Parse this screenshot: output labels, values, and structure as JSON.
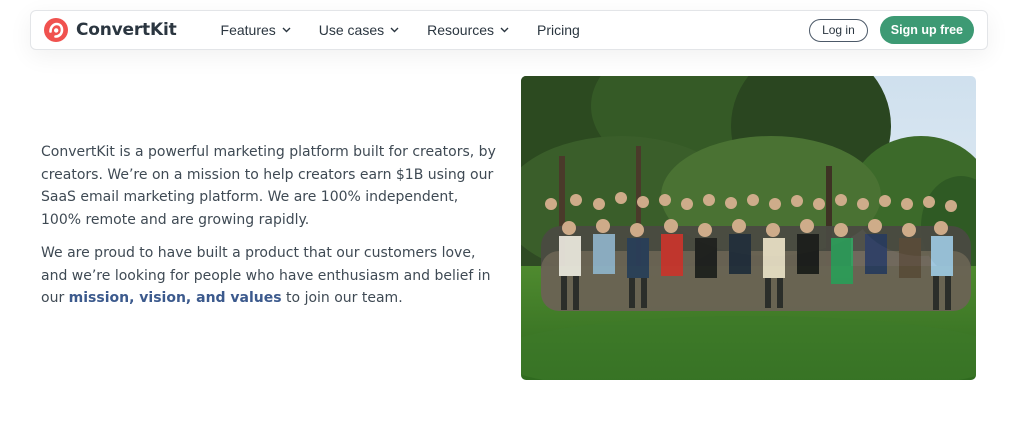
{
  "header": {
    "brand": "ConvertKit",
    "logo_icon": "convertkit-logo-icon",
    "nav": [
      {
        "label": "Features",
        "has_dropdown": true
      },
      {
        "label": "Use cases",
        "has_dropdown": true
      },
      {
        "label": "Resources",
        "has_dropdown": true
      },
      {
        "label": "Pricing",
        "has_dropdown": false
      }
    ],
    "login_label": "Log in",
    "signup_label": "Sign up free"
  },
  "content": {
    "paragraph1": "ConvertKit is a powerful marketing platform built for creators, by creators. We’re on a mission to help creators earn $1B using our SaaS email marketing platform. We are 100% independent, 100% remote and are growing rapidly.",
    "paragraph2_before": "We are proud to have built a product that our customers love, and we’re looking for people who have enthusiasm and belief in our ",
    "paragraph2_link": "mission, vision, and values",
    "paragraph2_after": " to join our team."
  },
  "photo": {
    "subject": "team-group-photo"
  },
  "colors": {
    "brand_red": "#f0524f",
    "signup_green": "#3d9a74",
    "link_blue": "#3c5a8d",
    "text": "#3f4a54"
  }
}
